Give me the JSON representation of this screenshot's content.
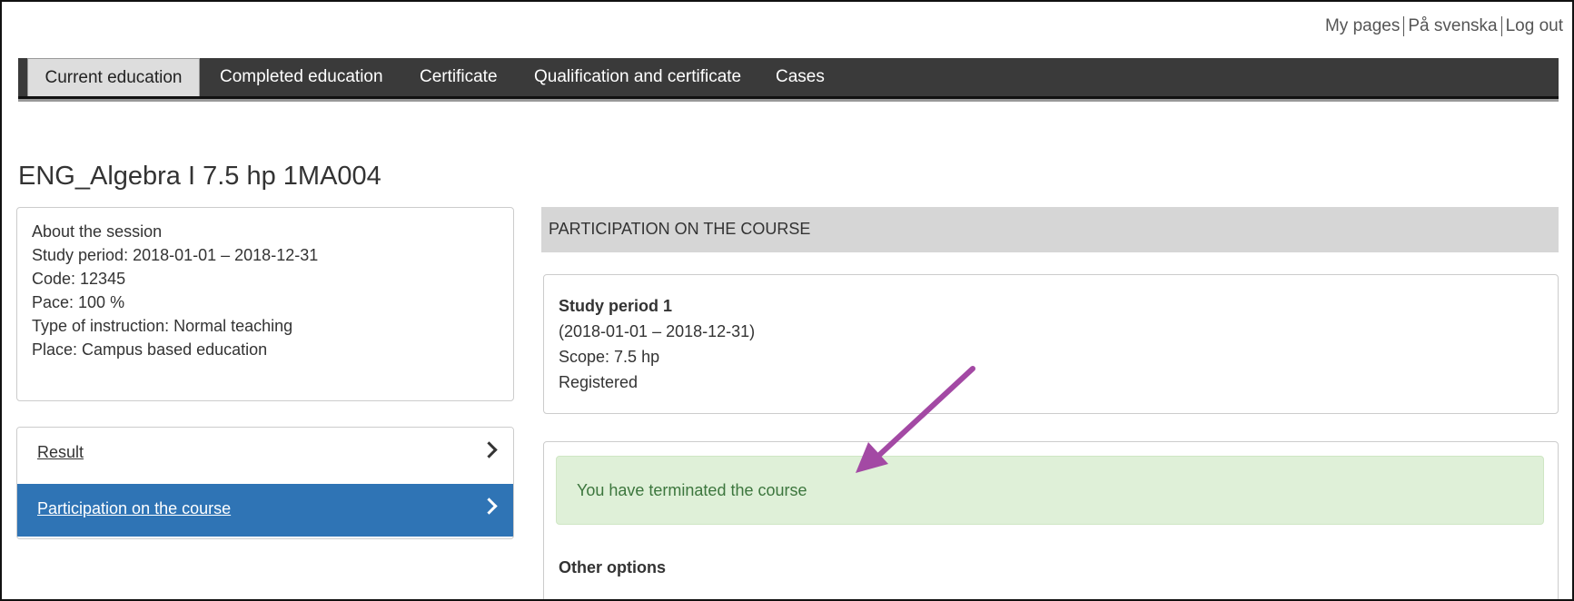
{
  "header": {
    "links": [
      "My pages",
      "På svenska",
      "Log out"
    ]
  },
  "nav": {
    "tabs": [
      {
        "label": "Current education",
        "active": true
      },
      {
        "label": "Completed education",
        "active": false
      },
      {
        "label": "Certificate",
        "active": false
      },
      {
        "label": "Qualification and certificate",
        "active": false
      },
      {
        "label": "Cases",
        "active": false
      }
    ]
  },
  "page_title": "ENG_Algebra I 7.5 hp 1MA004",
  "session": {
    "heading": "About the session",
    "lines": [
      "Study period:  2018-01-01 – 2018-12-31",
      "Code:  12345",
      "Pace:  100 %",
      "Type of instruction:  Normal teaching",
      "Place:  Campus based education"
    ]
  },
  "sidebar": {
    "items": [
      {
        "label": "Result",
        "active": false
      },
      {
        "label": "Participation on the course",
        "active": true
      }
    ]
  },
  "participation": {
    "heading": "PARTICIPATION ON THE COURSE",
    "period_title": "Study period 1",
    "period_range": "(2018-01-01 – 2018-12-31)",
    "scope": "Scope:  7.5 hp",
    "status": "Registered",
    "alert": "You have terminated the course",
    "other_options": "Other options"
  },
  "colors": {
    "nav_bg": "#3a3a3a",
    "active_item": "#2f74b5",
    "alert_bg": "#dff0d8",
    "alert_text": "#3c763d",
    "annotation_arrow": "#a349a4"
  }
}
